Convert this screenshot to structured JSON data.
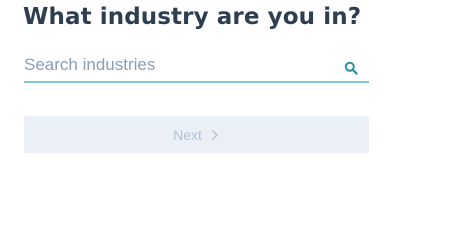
{
  "page": {
    "title": "What industry are you in?"
  },
  "search": {
    "placeholder": "Search industries",
    "value": "",
    "icon": "search-icon"
  },
  "next_button": {
    "label": "Next",
    "icon": "chevron-right-icon",
    "disabled": true
  },
  "colors": {
    "title": "#2d3e50",
    "placeholder": "#8aa0b5",
    "underline": "#7fc9d1",
    "search_icon": "#2a8fa0",
    "button_bg": "#eaf0f6",
    "button_text": "#b0c1d4"
  }
}
